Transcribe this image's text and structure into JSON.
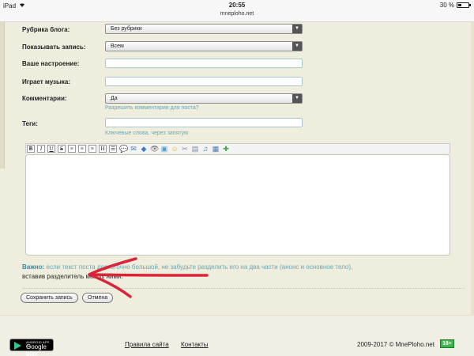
{
  "status_bar": {
    "device": "iPad",
    "time": "20:55",
    "url": "mneploho.net",
    "battery": "30 %",
    "battery_level": 0.3
  },
  "form": {
    "category": {
      "label": "Рубрика блога:",
      "value": "Без рубрики"
    },
    "visibility": {
      "label": "Показывать запись:",
      "value": "Всем"
    },
    "mood": {
      "label": "Ваше настроение:",
      "value": ""
    },
    "music": {
      "label": "Играет музыка:",
      "value": ""
    },
    "comments": {
      "label": "Комментарии:",
      "value": "Да",
      "hint": "Разрешить комментарии для поста?"
    },
    "tags": {
      "label": "Теги:",
      "value": "",
      "hint": "Ключевые слова, через запятую"
    }
  },
  "toolbar": [
    {
      "icon": "bold-icon",
      "glyph": "B"
    },
    {
      "icon": "italic-icon",
      "glyph": "I"
    },
    {
      "icon": "underline-icon",
      "glyph": "U"
    },
    {
      "icon": "strikethrough-icon",
      "glyph": "S"
    },
    {
      "icon": "align-left-icon",
      "glyph": "≡"
    },
    {
      "icon": "align-center-icon",
      "glyph": "≡"
    },
    {
      "icon": "align-right-icon",
      "glyph": "≡"
    },
    {
      "icon": "heading-icon",
      "glyph": "H"
    },
    {
      "icon": "list-icon",
      "glyph": "☰"
    },
    {
      "icon": "quote-icon",
      "glyph": "💬"
    },
    {
      "icon": "email-icon",
      "glyph": "✉"
    },
    {
      "icon": "code-icon",
      "glyph": "◆"
    },
    {
      "icon": "spoiler-icon",
      "glyph": "👁"
    },
    {
      "icon": "image-icon",
      "glyph": "▣"
    },
    {
      "icon": "smiley-icon",
      "glyph": "☺"
    },
    {
      "icon": "cut-icon",
      "glyph": "✂"
    },
    {
      "icon": "video-icon",
      "glyph": "▤"
    },
    {
      "icon": "music-icon",
      "glyph": "♫"
    },
    {
      "icon": "gallery-icon",
      "glyph": "▦"
    },
    {
      "icon": "add-icon",
      "glyph": "✚"
    }
  ],
  "note": {
    "bold": "Важно:",
    "text": " если текст поста достаточно большой, не забудьте разделить его на два части (анонс и основное тело),",
    "line2": "вставив разделитель между ними."
  },
  "buttons": {
    "save": "Сохранить запись",
    "cancel": "Отмена"
  },
  "footer": {
    "play_small": "ANDROID APP ON",
    "play_big": "Google play",
    "rules": "Правила сайта",
    "contacts": "Контакты",
    "copyright": "2009-2017 © MnePloho.net",
    "age": "18+"
  },
  "colors": {
    "page_bg": "#efedde",
    "hint": "#6aa7b4",
    "annotation_arrow": "#d9253a",
    "age_badge": "#39b54a"
  }
}
